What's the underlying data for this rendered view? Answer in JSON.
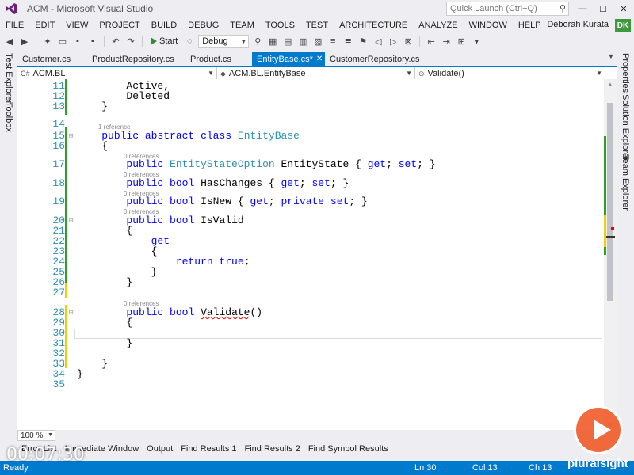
{
  "window": {
    "title": "ACM - Microsoft Visual Studio",
    "quick_launch_placeholder": "Quick Launch (Ctrl+Q)",
    "user_name": "Deborah Kurata",
    "user_initials": "DK"
  },
  "menu": [
    "FILE",
    "EDIT",
    "VIEW",
    "PROJECT",
    "BUILD",
    "DEBUG",
    "TEAM",
    "TOOLS",
    "TEST",
    "ARCHITECTURE",
    "ANALYZE",
    "WINDOW",
    "HELP"
  ],
  "toolbar": {
    "start_label": "Start",
    "config_value": "Debug"
  },
  "left_panel_tabs": [
    "Test Explorer",
    "Toolbox"
  ],
  "right_panel_tabs": [
    "Properties",
    "Solution Explorer",
    "Team Explorer"
  ],
  "tabs": [
    {
      "label": "Customer.cs",
      "active": false
    },
    {
      "label": "ProductRepository.cs",
      "active": false
    },
    {
      "label": "Product.cs",
      "active": false
    },
    {
      "label": "EntityBase.cs*",
      "active": true
    },
    {
      "label": "CustomerRepository.cs",
      "active": false
    }
  ],
  "navbar": {
    "project": "ACM.BL",
    "type": "ACM.BL.EntityBase",
    "member": "Validate()"
  },
  "editor": {
    "lines": [
      {
        "n": "11",
        "code": "        Active,"
      },
      {
        "n": "12",
        "code": "        Deleted"
      },
      {
        "n": "13",
        "code": "    }"
      },
      {
        "n": "14",
        "code": ""
      },
      {
        "n": "15",
        "code": "    public abstract class EntityBase"
      },
      {
        "n": "16",
        "code": "    {"
      },
      {
        "n": "17",
        "code": "        public EntityStateOption EntityState { get; set; }"
      },
      {
        "n": "18",
        "code": "        public bool HasChanges { get; set; }"
      },
      {
        "n": "19",
        "code": "        public bool IsNew { get; private set; }"
      },
      {
        "n": "20",
        "code": "        public bool IsValid"
      },
      {
        "n": "21",
        "code": "        {"
      },
      {
        "n": "22",
        "code": "            get"
      },
      {
        "n": "23",
        "code": "            {"
      },
      {
        "n": "24",
        "code": "                return true;"
      },
      {
        "n": "25",
        "code": "            }"
      },
      {
        "n": "26",
        "code": "        }"
      },
      {
        "n": "27",
        "code": ""
      },
      {
        "n": "28",
        "code": "        public bool Validate()"
      },
      {
        "n": "29",
        "code": "        {"
      },
      {
        "n": "30",
        "code": ""
      },
      {
        "n": "31",
        "code": "        }"
      },
      {
        "n": "32",
        "code": ""
      },
      {
        "n": "33",
        "code": "    }"
      },
      {
        "n": "34",
        "code": "}"
      },
      {
        "n": "35",
        "code": ""
      }
    ],
    "references": {
      "class": "1 reference",
      "entity_state": "0 references",
      "has_changes": "0 references",
      "is_new": "0 references",
      "is_valid": "0 references",
      "validate": "0 references"
    }
  },
  "zoom": "100 %",
  "bottom_tabs": [
    "Error List",
    "Immediate Window",
    "Output",
    "Find Results 1",
    "Find Results 2",
    "Find Symbol Results"
  ],
  "status": {
    "state": "Ready",
    "ln": "Ln 30",
    "col": "Col 13",
    "ch": "Ch 13"
  },
  "overlay": {
    "timer": "00:07:30",
    "brand": "pluralsight"
  },
  "colors": {
    "accent": "#007acc",
    "keyword": "#0000ff",
    "type": "#2b91af",
    "brand": "#f15b2a",
    "change_saved": "#2ba12b",
    "change_unsaved": "#f0d000"
  }
}
